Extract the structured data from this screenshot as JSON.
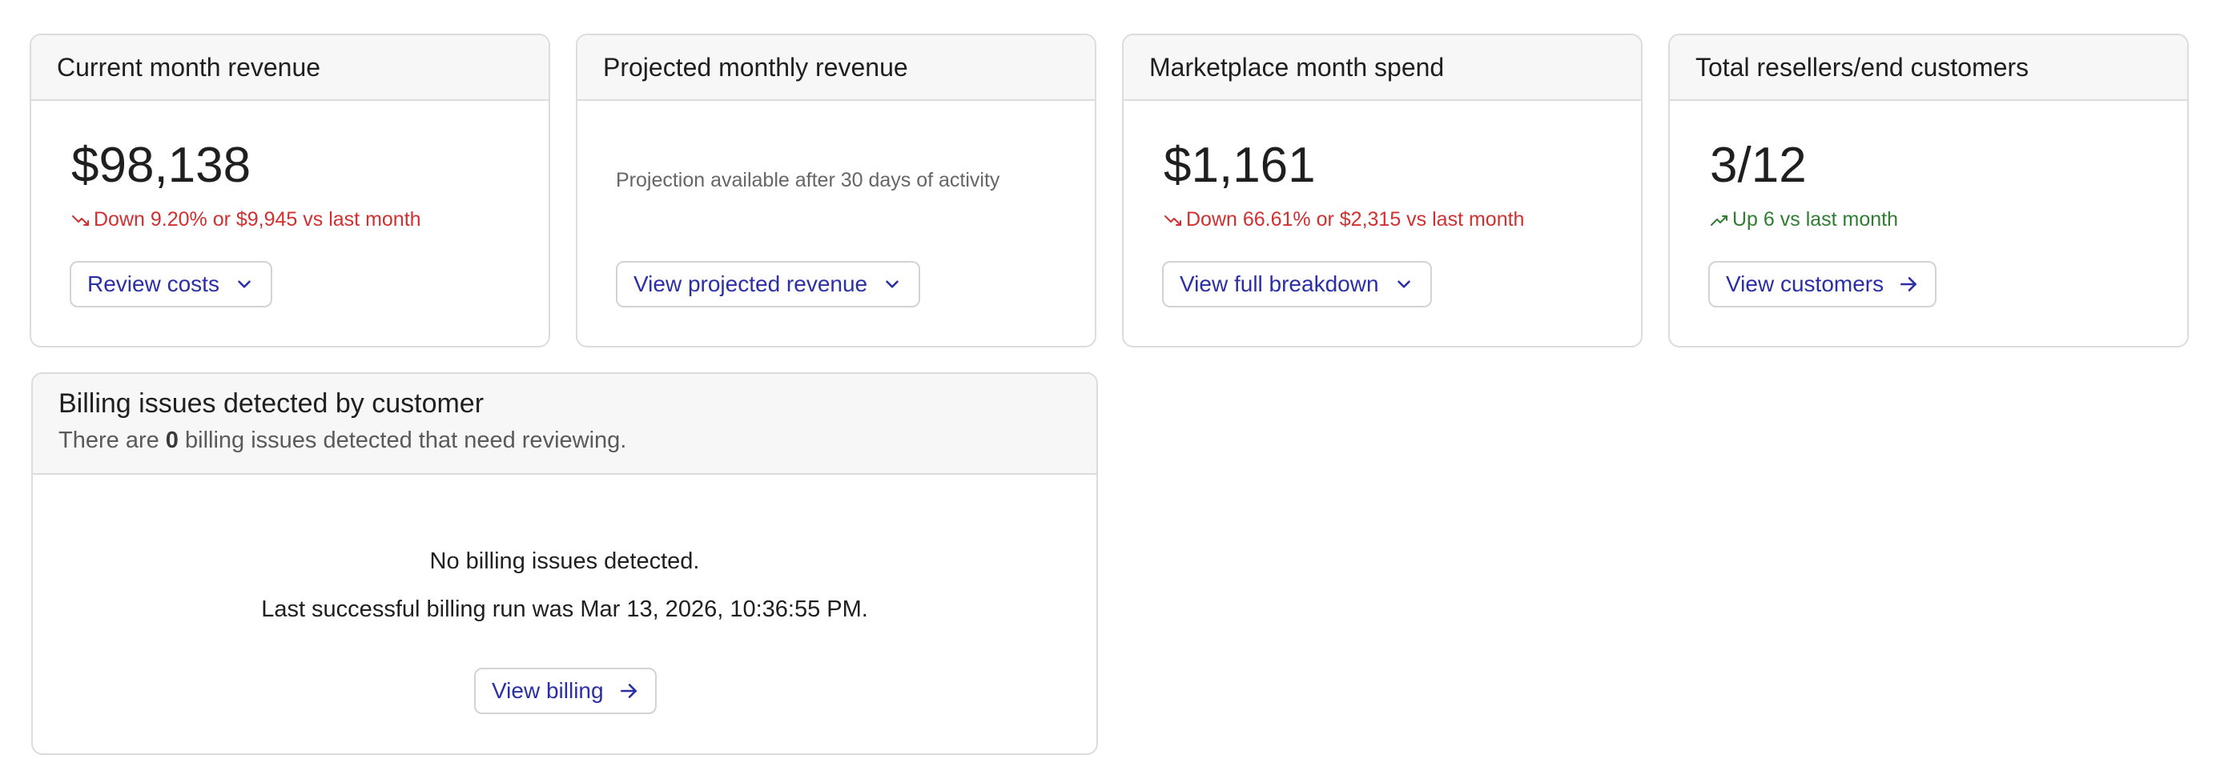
{
  "cards": [
    {
      "title": "Current month revenue",
      "value": "$98,138",
      "trend": "Down 9.20% or $9,945 vs last month",
      "trend_direction": "down",
      "button_label": "Review costs",
      "button_icon": "chevron-down-icon"
    },
    {
      "title": "Projected monthly revenue",
      "note": "Projection available after 30 days of activity",
      "button_label": "View projected revenue",
      "button_icon": "chevron-down-icon"
    },
    {
      "title": "Marketplace month spend",
      "value": "$1,161",
      "trend": "Down 66.61% or $2,315 vs last month",
      "trend_direction": "down",
      "button_label": "View full breakdown",
      "button_icon": "chevron-down-icon"
    },
    {
      "title": "Total resellers/end customers",
      "value": "3/12",
      "trend": "Up 6 vs last month",
      "trend_direction": "up",
      "button_label": "View customers",
      "button_icon": "arrow-right-icon"
    }
  ],
  "billing": {
    "title": "Billing issues detected by customer",
    "subtitle_prefix": "There are ",
    "issue_count": "0",
    "subtitle_suffix": " billing issues detected that need reviewing.",
    "status": "No billing issues detected.",
    "last_run": "Last successful billing run was Mar 13, 2026, 10:36:55 PM.",
    "button_label": "View billing",
    "button_icon": "arrow-right-icon"
  },
  "colors": {
    "accent": "#2b2fa4",
    "down": "#d03030",
    "up": "#2f7d32",
    "header_bg": "#f7f7f7",
    "border": "#dcdcdc"
  }
}
